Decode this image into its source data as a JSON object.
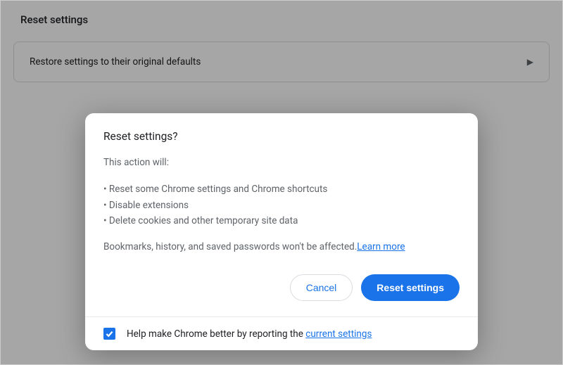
{
  "background": {
    "title": "Reset settings",
    "row_label": "Restore settings to their original defaults"
  },
  "dialog": {
    "title": "Reset settings?",
    "intro": "This action will:",
    "bullets": [
      "• Reset some Chrome settings and Chrome shortcuts",
      "• Disable extensions",
      "• Delete cookies and other temporary site data"
    ],
    "info_prefix": "Bookmarks, history, and saved passwords won't be affected.",
    "learn_more": "Learn more",
    "cancel_label": "Cancel",
    "confirm_label": "Reset settings",
    "footer_prefix": "Help make Chrome better by reporting the ",
    "footer_link": "current settings"
  }
}
